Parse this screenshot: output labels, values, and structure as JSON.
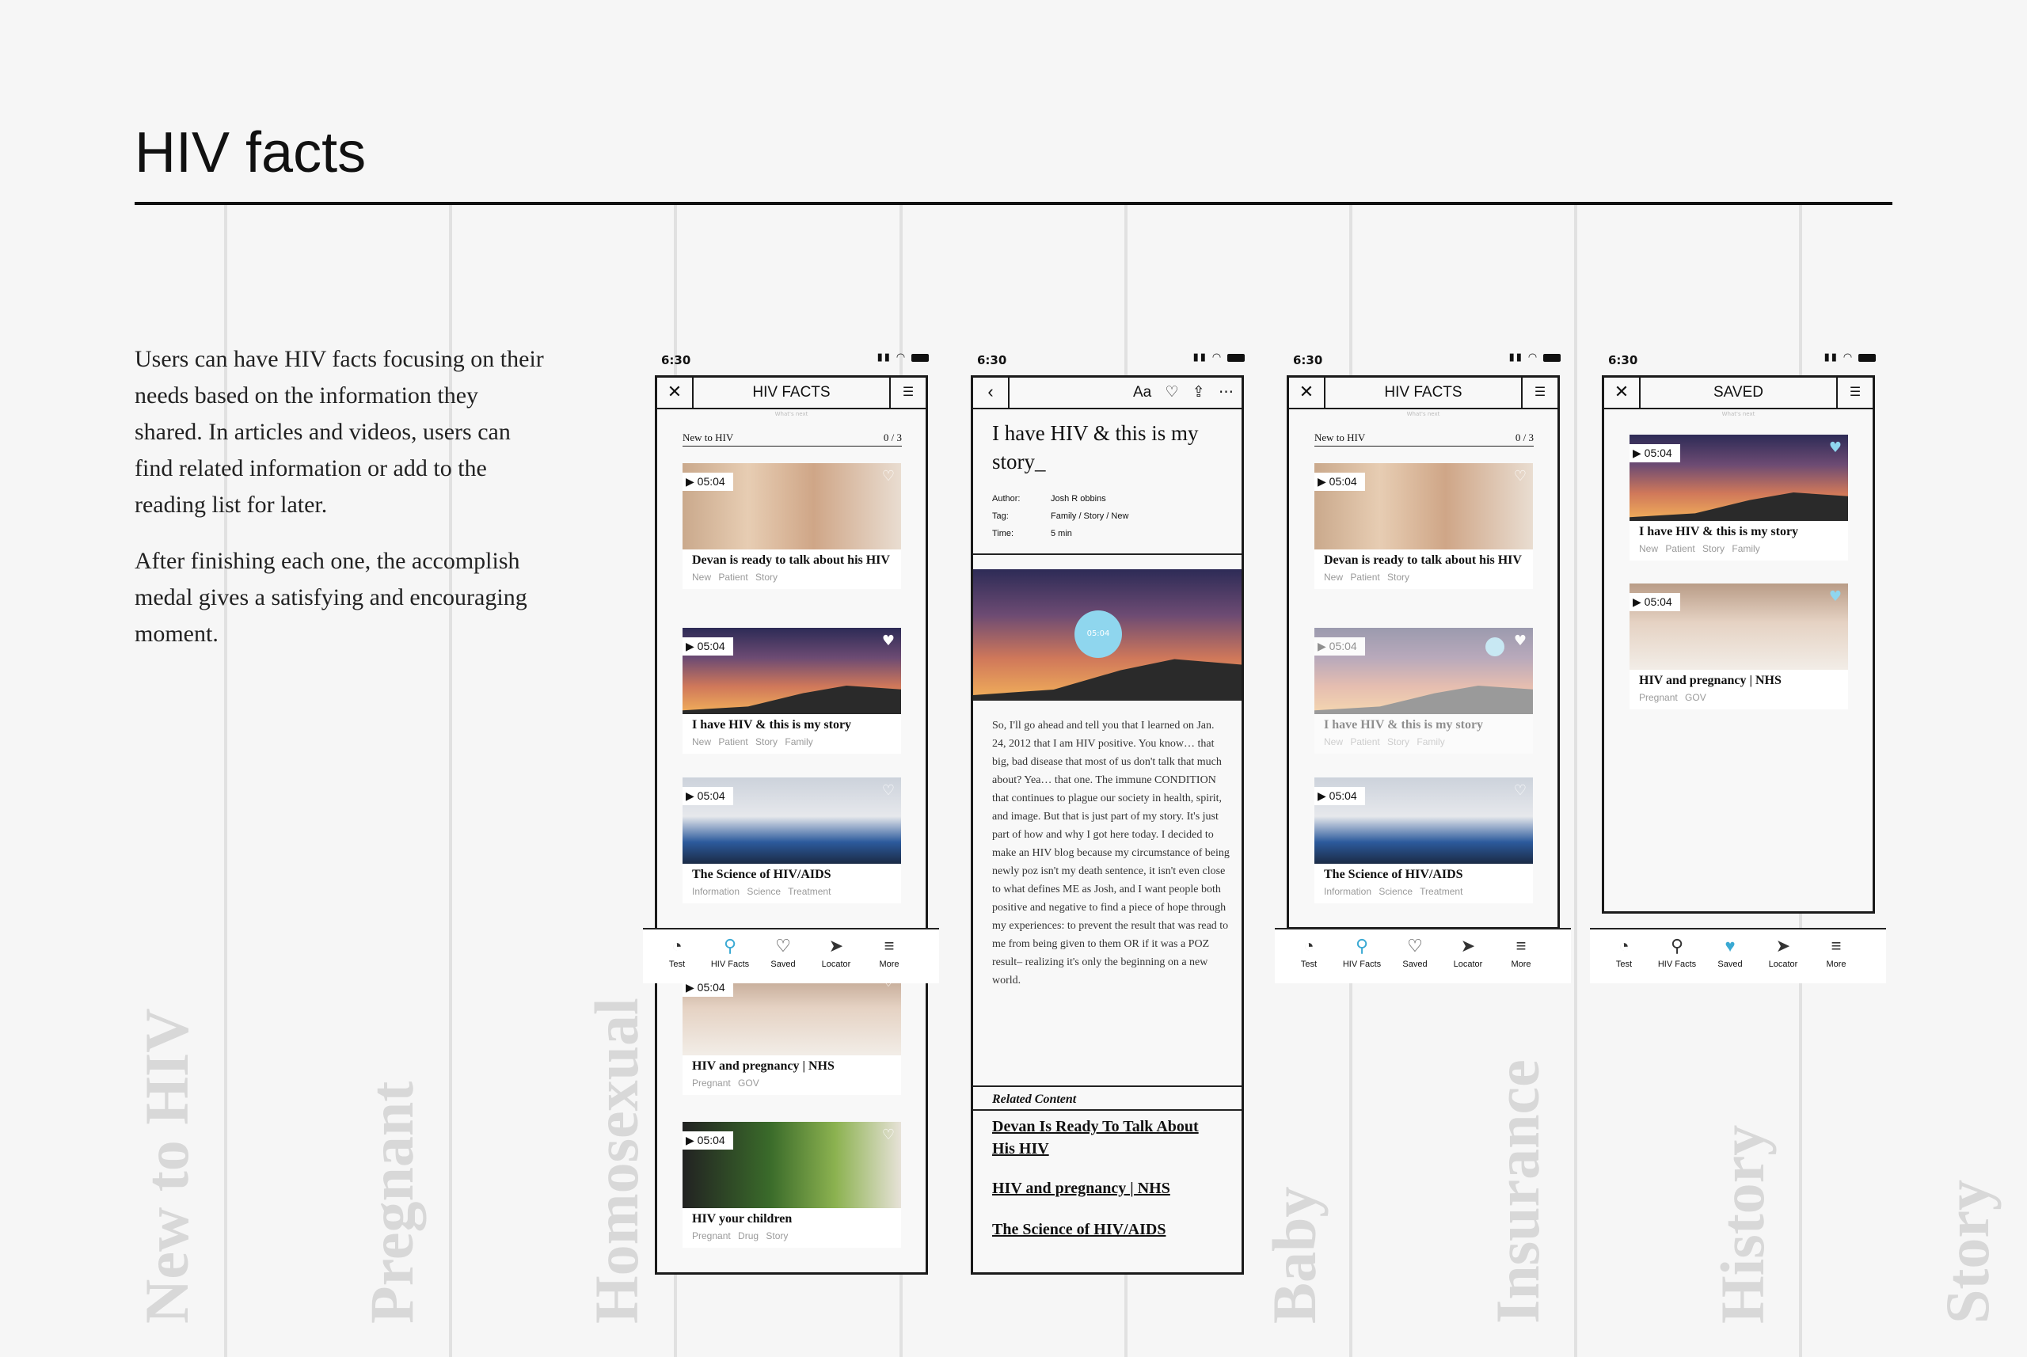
{
  "page": {
    "title": "HIV facts",
    "paragraphs": [
      "Users can have HIV facts focusing on their needs based on the information they shared. In articles and videos, users can find related information or add to the reading list for later.",
      "After finishing each one, the accomplish medal gives a satisfying and encouraging moment."
    ]
  },
  "background_words": [
    "New to HIV",
    "Pregnant",
    "Homosexual",
    "Baby",
    "Insurance",
    "History",
    "Story"
  ],
  "status": {
    "time": "6:30"
  },
  "screen1": {
    "header": "HIV FACTS",
    "sub": "What's next",
    "section": "New to HIV",
    "count": "0 / 3",
    "cards": [
      {
        "time": "05:04",
        "title": "Devan is ready to talk about his HIV",
        "tags": "New Patient Story"
      },
      {
        "time": "05:04",
        "title": "I have HIV & this is my story",
        "tags": "New Patient Story Family"
      },
      {
        "time": "05:04",
        "title": "The Science of HIV/AIDS",
        "tags": "Information Science Treatment"
      },
      {
        "time": "05:04",
        "title": "HIV and pregnancy | NHS",
        "tags": "Pregnant GOV"
      },
      {
        "time": "05:04",
        "title": "HIV your children",
        "tags": "Pregnant Drug Story"
      }
    ]
  },
  "tabs": [
    "Test",
    "HIV Facts",
    "Saved",
    "Locator",
    "More"
  ],
  "article": {
    "font_label": "Aa",
    "title": "I have HIV & this is my story_",
    "author_label": "Author:",
    "author": "Josh R obbins",
    "tag_label": "Tag:",
    "tags": "Family / Story / New",
    "time_label": "Time:",
    "time": "5 min",
    "play_time": "05:04",
    "body": "So, I'll go ahead and tell you that I learned on Jan. 24, 2012 that I am HIV positive. You know… that big, bad disease that most of us don't talk that much about? Yea… that one. The immune CONDITION that continues to plague our society in health, spirit, and image. But that is just part of my story. It's just part of how and why I got here today. I decided to make an HIV blog because my circumstance of being newly poz isn't my death sentence, it isn't even close to what defines ME as Josh, and I want people both positive and negative to find a piece of hope through my experiences: to prevent the result that was read to me from being given to them OR if it was a POZ result– realizing it's only the beginning on a new world.",
    "related_title": "Related Content",
    "related": [
      "Devan Is Ready To Talk About His HIV",
      "HIV and pregnancy | NHS",
      "The Science of HIV/AIDS"
    ]
  },
  "saved": {
    "header": "SAVED",
    "sub": "What's next",
    "cards": [
      {
        "time": "05:04",
        "title": "I have HIV & this is my story",
        "tags": "New Patient Story Family"
      },
      {
        "time": "05:04",
        "title": "HIV and pregnancy | NHS",
        "tags": "Pregnant GOV"
      }
    ]
  }
}
